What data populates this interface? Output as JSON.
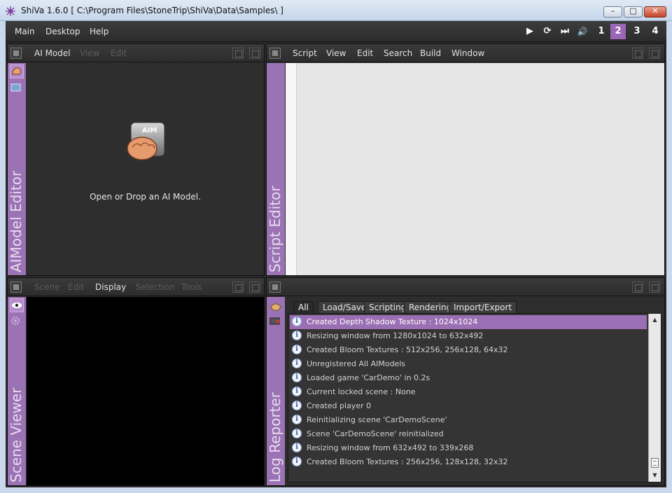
{
  "window": {
    "title": "ShiVa 1.6.0 [ C:\\Program Files\\StoneTrip\\ShiVa\\Data\\Samples\\ ]",
    "controls": {
      "minimize": "–",
      "maximize": "□",
      "close": "✕"
    }
  },
  "main_menu": [
    "Main",
    "Desktop",
    "Help"
  ],
  "playback": {
    "icons": [
      "play-icon",
      "refresh-icon",
      "step-icon",
      "volume-icon"
    ],
    "glyphs": [
      "▶",
      "⟳",
      "⏭",
      "🔊"
    ],
    "layouts": [
      "1",
      "2",
      "3",
      "4"
    ],
    "active_layout": "2"
  },
  "aimodel_editor": {
    "label": "AIModel Editor",
    "menu": [
      "AI Model",
      "View",
      "Edit"
    ],
    "icon_text": "AIM",
    "message": "Open or Drop an AI Model."
  },
  "script_editor": {
    "label": "Script Editor",
    "menu": [
      "Script",
      "View",
      "Edit",
      "Search",
      "Build",
      "Window"
    ]
  },
  "scene_viewer": {
    "label": "Scene Viewer",
    "menu": [
      "Scene",
      "Edit",
      "Display",
      "Selection",
      "Tools"
    ]
  },
  "log_reporter": {
    "label": "Log Reporter",
    "tabs": [
      "All",
      "Load/Save",
      "Scripting",
      "Rendering",
      "Import/Export"
    ],
    "active_tab": "All",
    "entries": [
      "Created Depth Shadow Texture : 1024x1024",
      "Resizing window from 1280x1024 to 632x492",
      "Created Bloom Textures : 512x256, 256x128, 64x32",
      "Unregistered All AIModels",
      "Loaded game 'CarDemo' in 0.2s",
      "Current locked scene : None",
      "Created player 0",
      "Reinitializing scene 'CarDemoScene'",
      "Scene 'CarDemoScene' reinitialized",
      "Resizing window from 632x492 to 339x268",
      "Created Bloom Textures : 256x256, 128x128, 32x32"
    ],
    "selected_index": 0
  },
  "colors": {
    "accent_purple": "#9b72b4",
    "panel_dark": "#2d2d2d",
    "selection": "#9b6fb3"
  }
}
